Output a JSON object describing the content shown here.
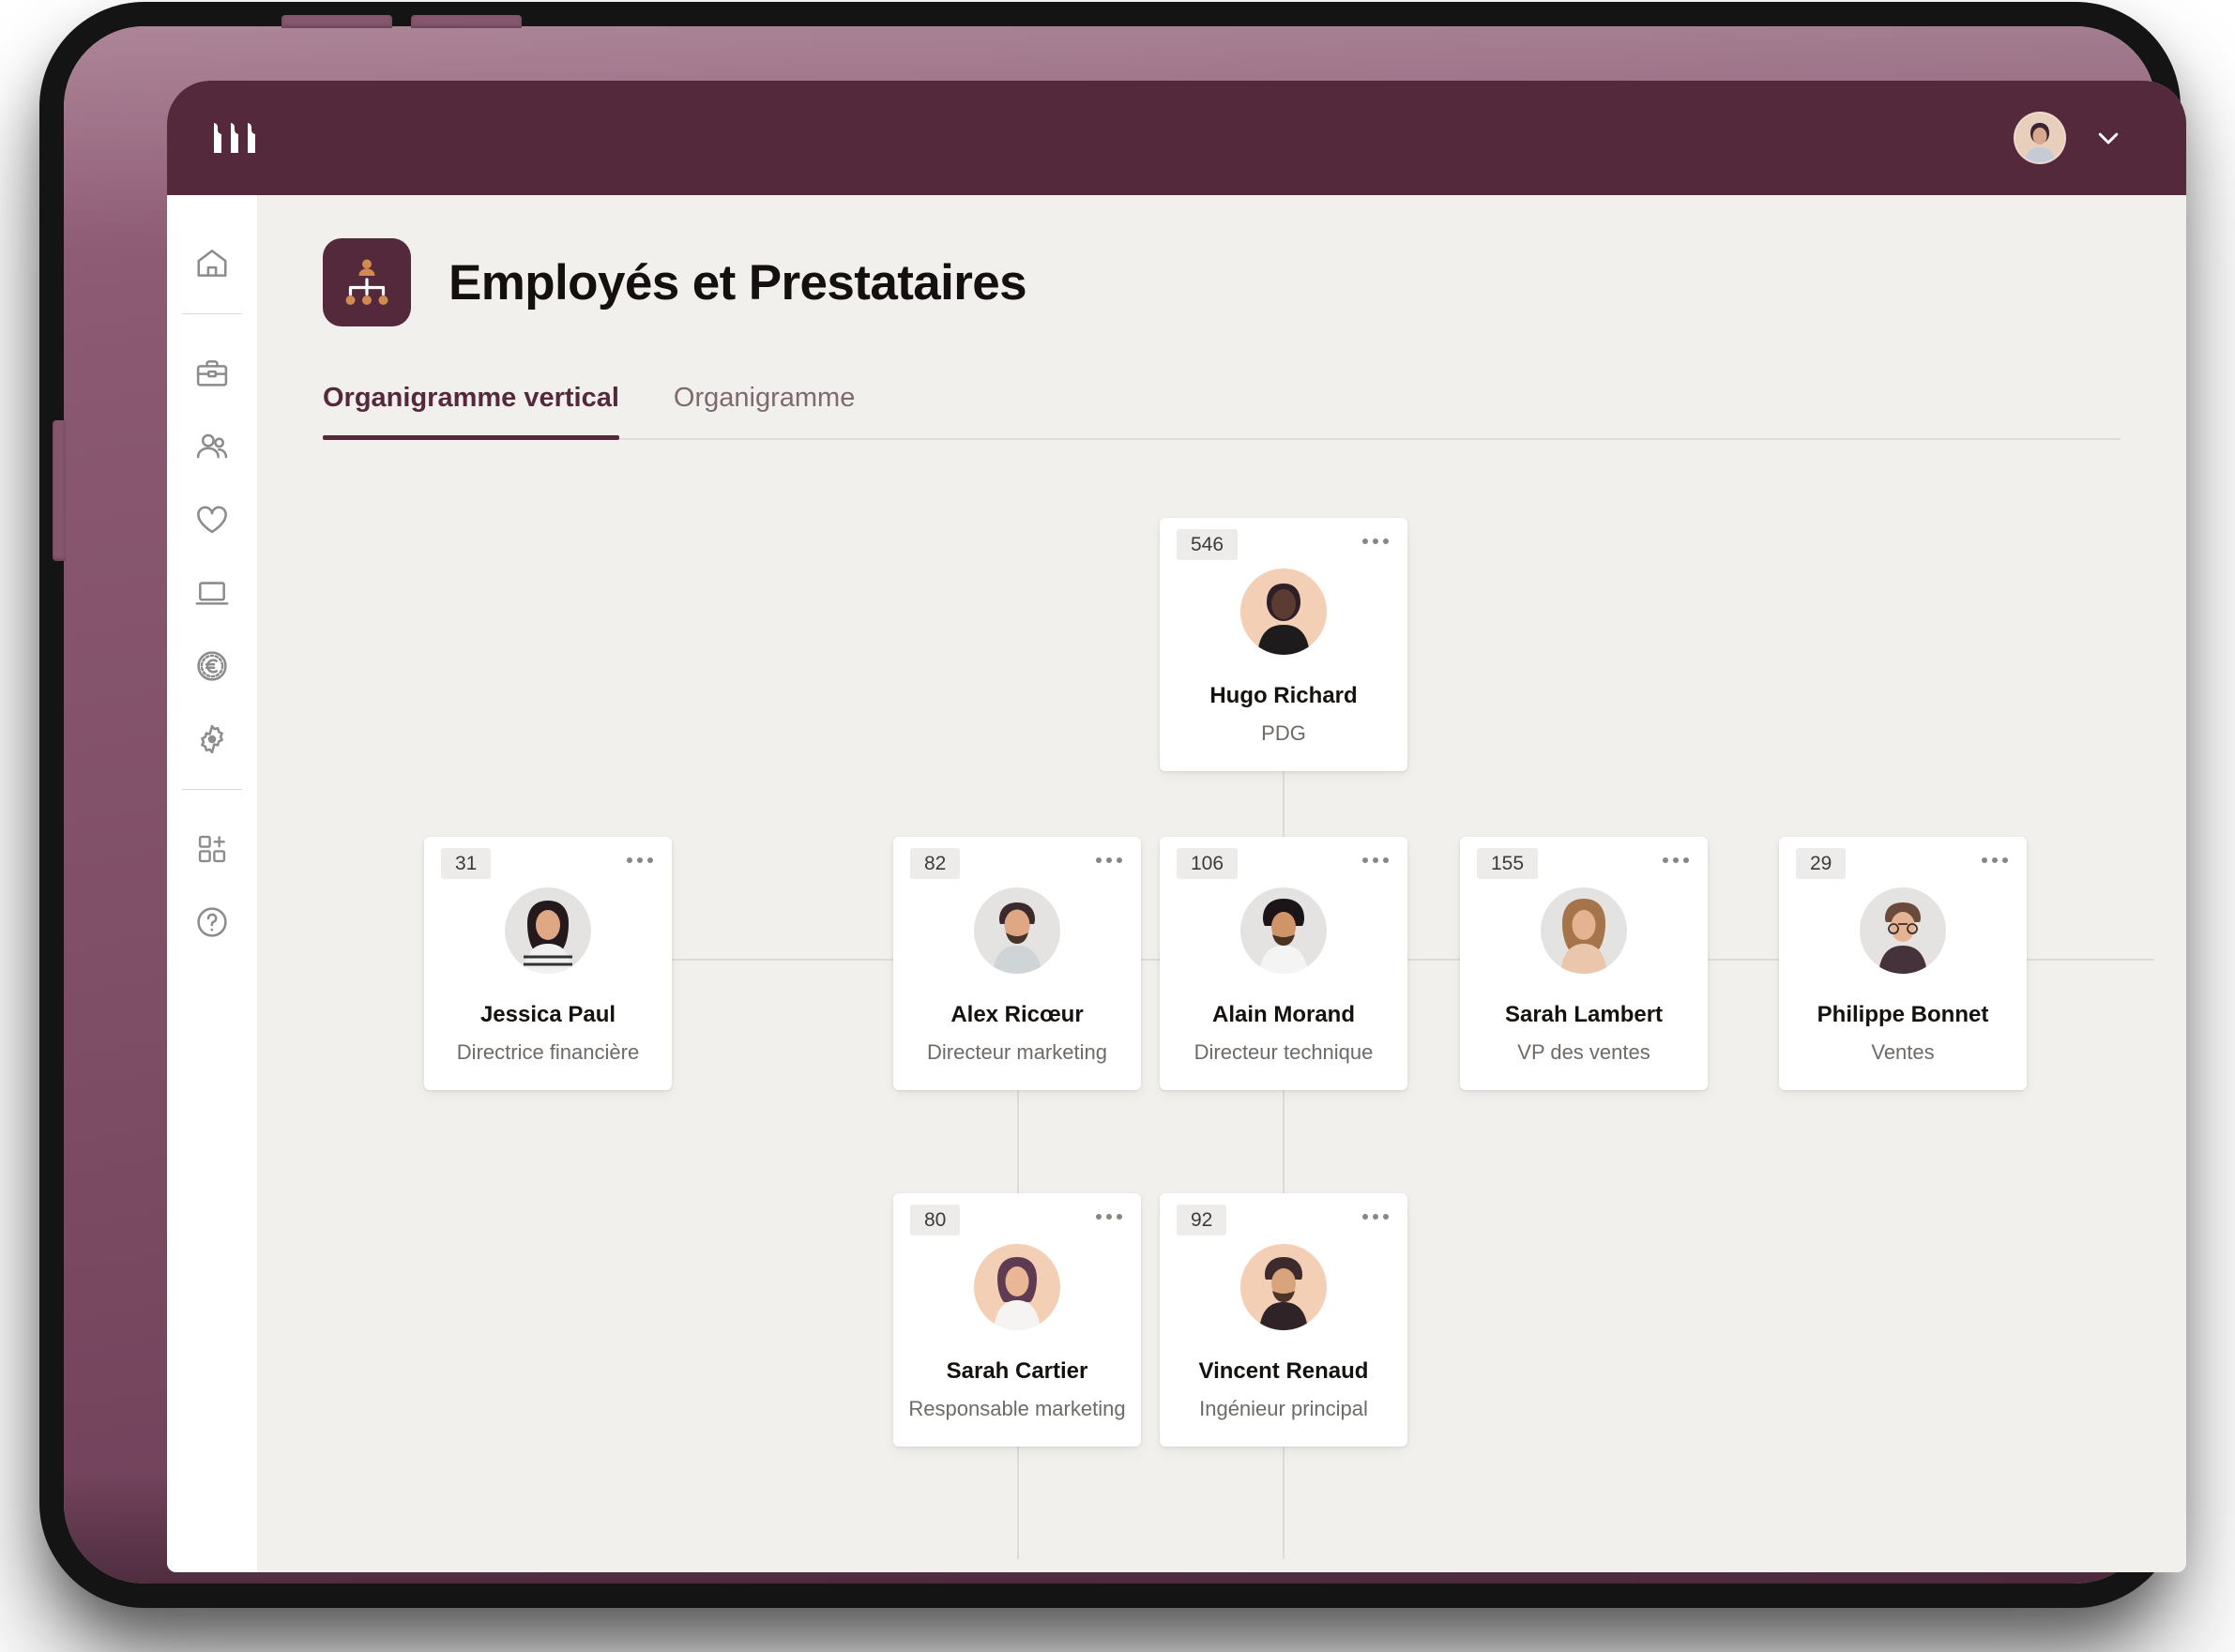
{
  "topbar": {
    "brand_logo_icon": "three-wave-bars-logo",
    "avatar_icon": "user-avatar",
    "chevron_icon": "chevron-down-icon"
  },
  "sidebar": {
    "items": [
      {
        "name": "home",
        "icon": "home-icon"
      },
      {
        "name": "briefcase",
        "icon": "briefcase-icon"
      },
      {
        "name": "people",
        "icon": "people-icon"
      },
      {
        "name": "heart",
        "icon": "heart-icon"
      },
      {
        "name": "laptop",
        "icon": "laptop-icon"
      },
      {
        "name": "payroll",
        "icon": "euro-coin-icon"
      },
      {
        "name": "settings",
        "icon": "gear-icon"
      },
      {
        "name": "apps",
        "icon": "add-apps-icon"
      },
      {
        "name": "help",
        "icon": "help-circle-icon"
      }
    ]
  },
  "page": {
    "icon": "org-chart-icon",
    "title": "Employés et Prestataires"
  },
  "tabs": [
    {
      "label": "Organigramme vertical",
      "active": true
    },
    {
      "label": "Organigramme",
      "active": false
    }
  ],
  "colors": {
    "brand_dark": "#54293c",
    "bezel": "#8a5871",
    "canvas": "#f2f0ed",
    "card": "#ffffff",
    "badge_bg": "#eeecea",
    "connector": "#dedbd6",
    "accent_orange": "#d08a52"
  },
  "chart_data": {
    "type": "org-chart",
    "title": "Employés et Prestataires",
    "levels": 3,
    "nodes": [
      {
        "id": "hugo",
        "badge": "546",
        "name": "Hugo Richard",
        "role": "PDG",
        "level": 0,
        "parent": null,
        "avatar": "avatar-man-dark",
        "menu": "kebab-menu"
      },
      {
        "id": "jessica",
        "badge": "31",
        "name": "Jessica Paul",
        "role": "Directrice financière",
        "level": 1,
        "parent": "hugo",
        "avatar": "avatar-woman-dark-hair",
        "menu": "kebab-menu"
      },
      {
        "id": "alex",
        "badge": "82",
        "name": "Alex Ricœur",
        "role": "Directeur marketing",
        "level": 1,
        "parent": "hugo",
        "avatar": "avatar-man-beard",
        "menu": "kebab-menu"
      },
      {
        "id": "alain",
        "badge": "106",
        "name": "Alain Morand",
        "role": "Directeur technique",
        "level": 1,
        "parent": "hugo",
        "avatar": "avatar-man-curly",
        "menu": "kebab-menu"
      },
      {
        "id": "sarahl",
        "badge": "155",
        "name": "Sarah Lambert",
        "role": "VP des ventes",
        "level": 1,
        "parent": "hugo",
        "avatar": "avatar-woman-blonde",
        "menu": "kebab-menu"
      },
      {
        "id": "philippe",
        "badge": "29",
        "name": "Philippe Bonnet",
        "role": "Ventes",
        "level": 1,
        "parent": "hugo",
        "avatar": "avatar-man-glasses",
        "menu": "kebab-menu"
      },
      {
        "id": "sarahc",
        "badge": "80",
        "name": "Sarah Cartier",
        "role": "Responsable marketing",
        "level": 2,
        "parent": "alex",
        "avatar": "avatar-woman-smiling",
        "menu": "kebab-menu"
      },
      {
        "id": "vincent",
        "badge": "92",
        "name": "Vincent Renaud",
        "role": "Ingénieur principal",
        "level": 2,
        "parent": "alain",
        "avatar": "avatar-man-young",
        "menu": "kebab-menu"
      }
    ]
  }
}
